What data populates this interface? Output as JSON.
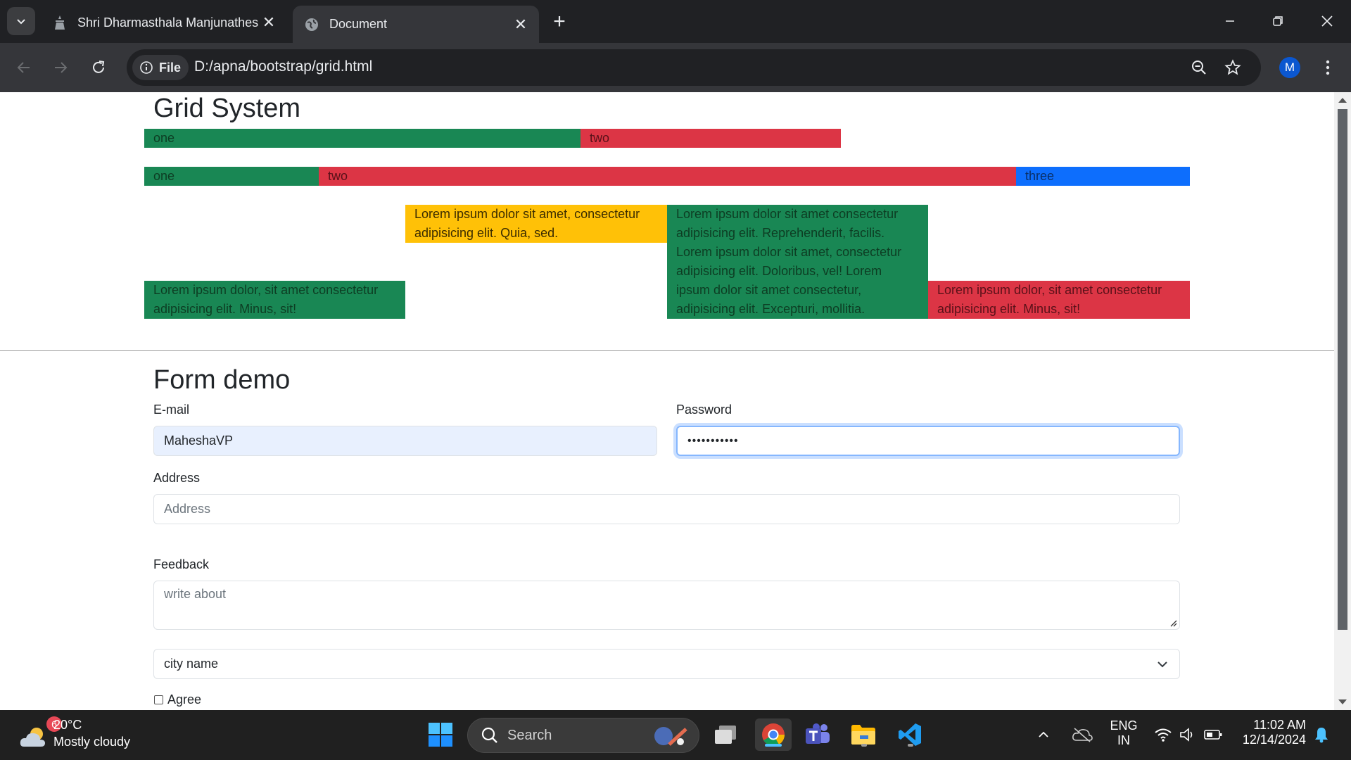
{
  "browser": {
    "tabs": [
      {
        "title": "Shri Dharmasthala Manjunatheshwara",
        "active": false
      },
      {
        "title": "Document",
        "active": true
      }
    ],
    "omnibox": {
      "scheme_chip": "File",
      "url": "D:/apna/bootstrap/grid.html"
    },
    "profile_initial": "M"
  },
  "page": {
    "grid_title": "Grid System",
    "row1": [
      "one",
      "two"
    ],
    "row2": [
      "one",
      "two",
      "three"
    ],
    "row3": {
      "green_left": "Lorem ipsum dolor, sit amet consectetur adipisicing elit. Minus, sit!",
      "yellow": "Lorem ipsum dolor sit amet, consectetur adipisicing elit. Quia, sed.",
      "green_tall": "Lorem ipsum dolor sit amet consectetur adipisicing elit. Reprehenderit, facilis. Lorem ipsum dolor sit amet, consectetur adipisicing elit. Doloribus, vel! Lorem ipsum dolor sit amet consectetur, adipisicing elit. Excepturi, mollitia.",
      "red_right": "Lorem ipsum dolor, sit amet consectetur adipisicing elit. Minus, sit!"
    },
    "form_title": "Form demo",
    "form": {
      "email_label": "E-mail",
      "email_value": "MaheshaVP",
      "password_label": "Password",
      "password_value": "•••••••••••",
      "address_label": "Address",
      "address_placeholder": "Address",
      "feedback_label": "Feedback",
      "feedback_placeholder": "write about",
      "city_selected": "city name",
      "agree_label": "Agree"
    }
  },
  "taskbar": {
    "weather_badge": "6",
    "weather_temp": "20°C",
    "weather_desc": "Mostly cloudy",
    "search_label": "Search",
    "lang_1": "ENG",
    "lang_2": "IN",
    "time": "11:02 AM",
    "date": "12/14/2024"
  },
  "colors": {
    "green": "#198754",
    "red": "#dc3545",
    "blue": "#0d6efd",
    "yellow": "#ffc107"
  }
}
